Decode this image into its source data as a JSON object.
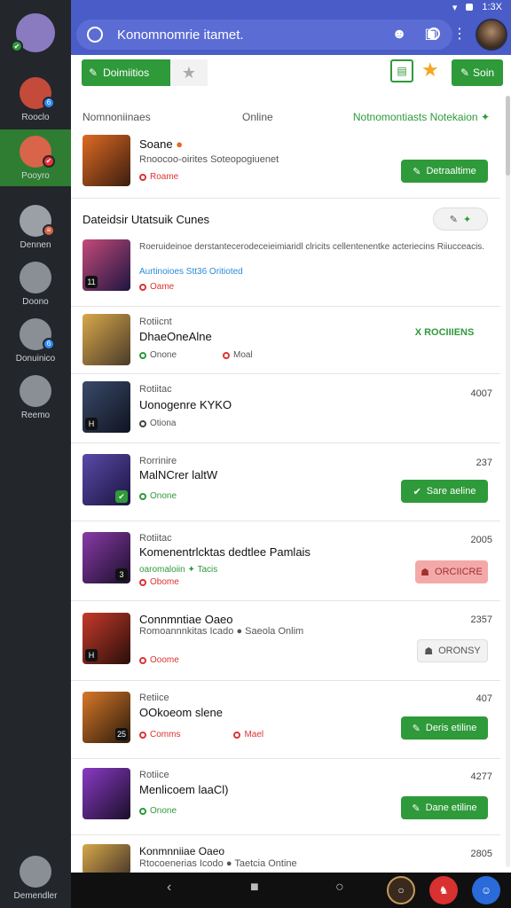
{
  "status_bar": {
    "time": "1:3X"
  },
  "app_bar": {
    "search_text": "Konomnomrie itamet."
  },
  "rail": {
    "items": [
      {
        "label": "",
        "color": "#8a7bc0",
        "badge": "✔",
        "badge_color": "#2e9a3a"
      },
      {
        "label": "Rooclo",
        "color": "#c44a3a",
        "badge": "6"
      },
      {
        "label": "Pooyro",
        "color": "#d8644a",
        "badge": "✔",
        "badge_color": "#e33"
      },
      {
        "label": "Dennen",
        "color": "#9aa0a6",
        "badge": "≡",
        "badge_color": "#d8644a"
      },
      {
        "label": "Doono",
        "color": "#8a8f96",
        "badge": ""
      },
      {
        "label": "Donuinico",
        "color": "#8a8f96",
        "badge": "6"
      },
      {
        "label": "Reemo",
        "color": "#8a8f96",
        "badge": ""
      },
      {
        "label": "Demendler",
        "color": "#8a8f96",
        "badge": ""
      }
    ]
  },
  "filters": {
    "primary": "Doimiitios",
    "right": "Soin"
  },
  "list_header": {
    "col1": "Nomnoniinaes",
    "col2": "Online",
    "col3": "Notnomontiasts Notekaion"
  },
  "rows": [
    {
      "sub": "",
      "title": "Soane",
      "desc": "Rnoocoo-oirites Soteopogiuenet",
      "meta": [
        {
          "t": "Roame",
          "c": "red"
        }
      ],
      "time": "",
      "action": "Detraaltime",
      "action_style": "green",
      "thumb": [
        "#e06a22",
        "#3a1e10"
      ],
      "tb": ""
    },
    {
      "sub": "",
      "title": "Dateidsir Utatsuik Cunes",
      "desc": "Roeruideinoe derstantecerodeceieimiaridl clricits cellentenentke acteriecins Riiucceacis.",
      "desc2": "Aurtinoioes Stt36 Oritioted",
      "meta": [
        {
          "t": "Oame",
          "c": "red"
        }
      ],
      "time": "",
      "action": "",
      "action_style": "",
      "thumb": [
        "#c44a7a",
        "#1e1640"
      ],
      "tb": "11"
    },
    {
      "sub": "Rotiicnt",
      "title": "DhaeOneAlne",
      "meta": [
        {
          "t": "Onone",
          "c": "green"
        },
        {
          "t": "Moal",
          "c": "red"
        }
      ],
      "time": "",
      "action": "X ROCIIIENS",
      "action_style": "outline",
      "thumb": [
        "#d8a84a",
        "#4a3a2a"
      ],
      "tb": ""
    },
    {
      "sub": "Rotiitac",
      "title": "Uonogenre KYKO",
      "meta": [
        {
          "t": "Otiona",
          "c": "grey"
        }
      ],
      "time": "4007",
      "action": "",
      "action_style": "",
      "thumb": [
        "#3a4a6a",
        "#0f1420"
      ],
      "tb": "H"
    },
    {
      "sub": "Rorrinire",
      "title": "MalNCrer laltW",
      "meta": [
        {
          "t": "Onone",
          "c": "green"
        }
      ],
      "time": "237",
      "action": "Sare aeline",
      "action_style": "green",
      "thumb": [
        "#5a4aa8",
        "#1a1440"
      ],
      "tb": ""
    },
    {
      "sub": "Rotiitac",
      "title": "Komenentrlcktas dedtlee Pamlais",
      "desc2": "oaromaloiin ✦ Tacis",
      "meta": [
        {
          "t": "Obome",
          "c": "red"
        }
      ],
      "time": "2005",
      "action": "ORCIICRE",
      "action_style": "pink",
      "thumb": [
        "#8a3aa8",
        "#1a0f2a"
      ],
      "tb": "3"
    },
    {
      "sub": "Connmntiae Oaeo",
      "title": "",
      "desc": "Romoannnkitas Icado ● Saeola Onlim",
      "meta": [
        {
          "t": "Ooome",
          "c": "red"
        }
      ],
      "time": "2357",
      "action": "ORONSY",
      "action_style": "grey",
      "thumb": [
        "#c43a2a",
        "#2a0f0a"
      ],
      "tb": "H"
    },
    {
      "sub": "Retiice",
      "title": "OOkoeom slene",
      "meta": [
        {
          "t": "Comms",
          "c": "red"
        },
        {
          "t": "Mael",
          "c": "red"
        }
      ],
      "time": "407",
      "action": "Deris etiline",
      "action_style": "green",
      "thumb": [
        "#d8782a",
        "#2a1a0a"
      ],
      "tb": "25"
    },
    {
      "sub": "Rotiice",
      "title": "Menlicoem laaCl)",
      "meta": [
        {
          "t": "Onone",
          "c": "green"
        }
      ],
      "time": "4277",
      "action": "Dane etiline",
      "action_style": "green",
      "thumb": [
        "#8a3ac4",
        "#1a0f2a"
      ],
      "tb": ""
    },
    {
      "sub": "Konmnniiae Oaeo",
      "title": "",
      "desc": "Rtocoenerias Icodo ● Taetcia Ontine",
      "meta": [],
      "time": "2805",
      "action": "",
      "action_style": "",
      "thumb": [
        "#d8a84a",
        "#4a3a2a"
      ],
      "tb": ""
    }
  ]
}
